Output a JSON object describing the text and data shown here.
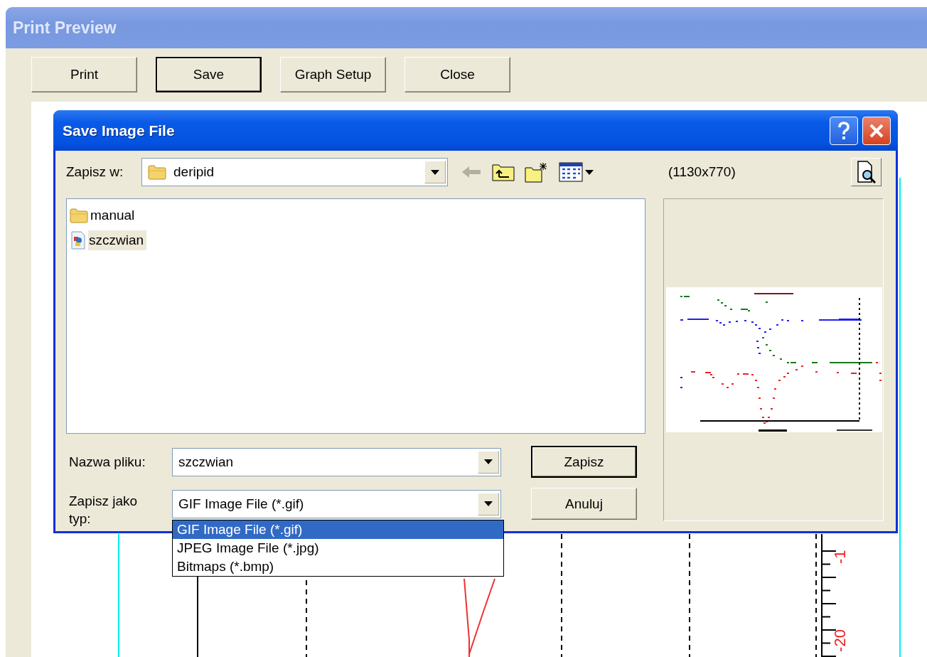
{
  "window": {
    "title": "Print Preview"
  },
  "toolbar": [
    {
      "label": "Print",
      "default": false
    },
    {
      "label": "Save",
      "default": true
    },
    {
      "label": "Graph Setup",
      "default": false
    },
    {
      "label": "Close",
      "default": false
    }
  ],
  "page": {
    "axis_labels": [
      "-1",
      "-20"
    ]
  },
  "dialog": {
    "title": "Save Image File",
    "save_in": {
      "label": "Zapisz w:",
      "value": "deripid"
    },
    "image_size": "(1130x770)",
    "files": [
      {
        "name": "manual",
        "kind": "folder",
        "selected": false
      },
      {
        "name": "szczwian",
        "kind": "image",
        "selected": true
      }
    ],
    "file_name": {
      "label": "Nazwa pliku:",
      "value": "szczwian"
    },
    "file_type": {
      "label": "Zapisz jako typ:",
      "value": "GIF Image File (*.gif)",
      "expanded": true,
      "options": [
        {
          "label": "GIF Image File (*.gif)",
          "selected": true
        },
        {
          "label": "JPEG Image File (*.jpg)",
          "selected": false
        },
        {
          "label": "Bitmaps (*.bmp)",
          "selected": false
        }
      ]
    },
    "buttons": [
      {
        "label": "Zapisz",
        "default": true
      },
      {
        "label": "Anuluj",
        "default": false
      }
    ]
  }
}
